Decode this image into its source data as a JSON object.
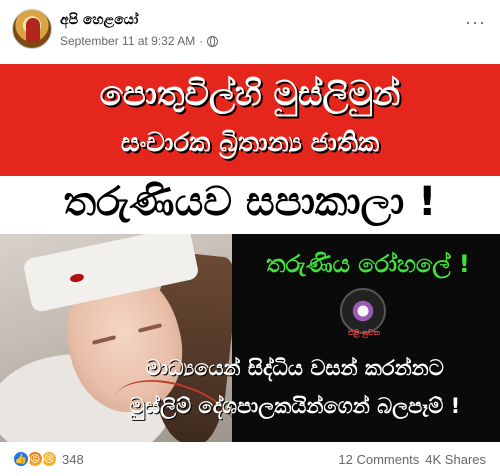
{
  "post": {
    "page_name": "අපි හෙළයෝ",
    "timestamp": "September 11 at 9:32 AM",
    "separator": "·",
    "privacy_icon": "globe-icon",
    "more_label": "···"
  },
  "poster": {
    "line1": "පොතුවිල්හි මුස්ලිමුන්",
    "line2": "සංචාරක බ්‍රිතාන්‍ය ජාතික",
    "line3": "තරුණියව සපාකාලා !",
    "line4": "තරුණිය රෝහලේ !",
    "logo_text": "එළි පුවත",
    "line5": "මාධ්‍යයෙන් සිද්ධිය වසන් කරන්නට",
    "line6": "මුස්ලිම් දේශපාලකයින්ගෙන් බලපෑම් !",
    "colors": {
      "red": "#e5261d",
      "green": "#3fe43a",
      "black": "#0a0a0a"
    }
  },
  "footer": {
    "reaction_icons": [
      "like-icon",
      "angry-icon",
      "sad-icon"
    ],
    "reaction_count": "348",
    "comments": "12 Comments",
    "shares": "4K Shares"
  }
}
